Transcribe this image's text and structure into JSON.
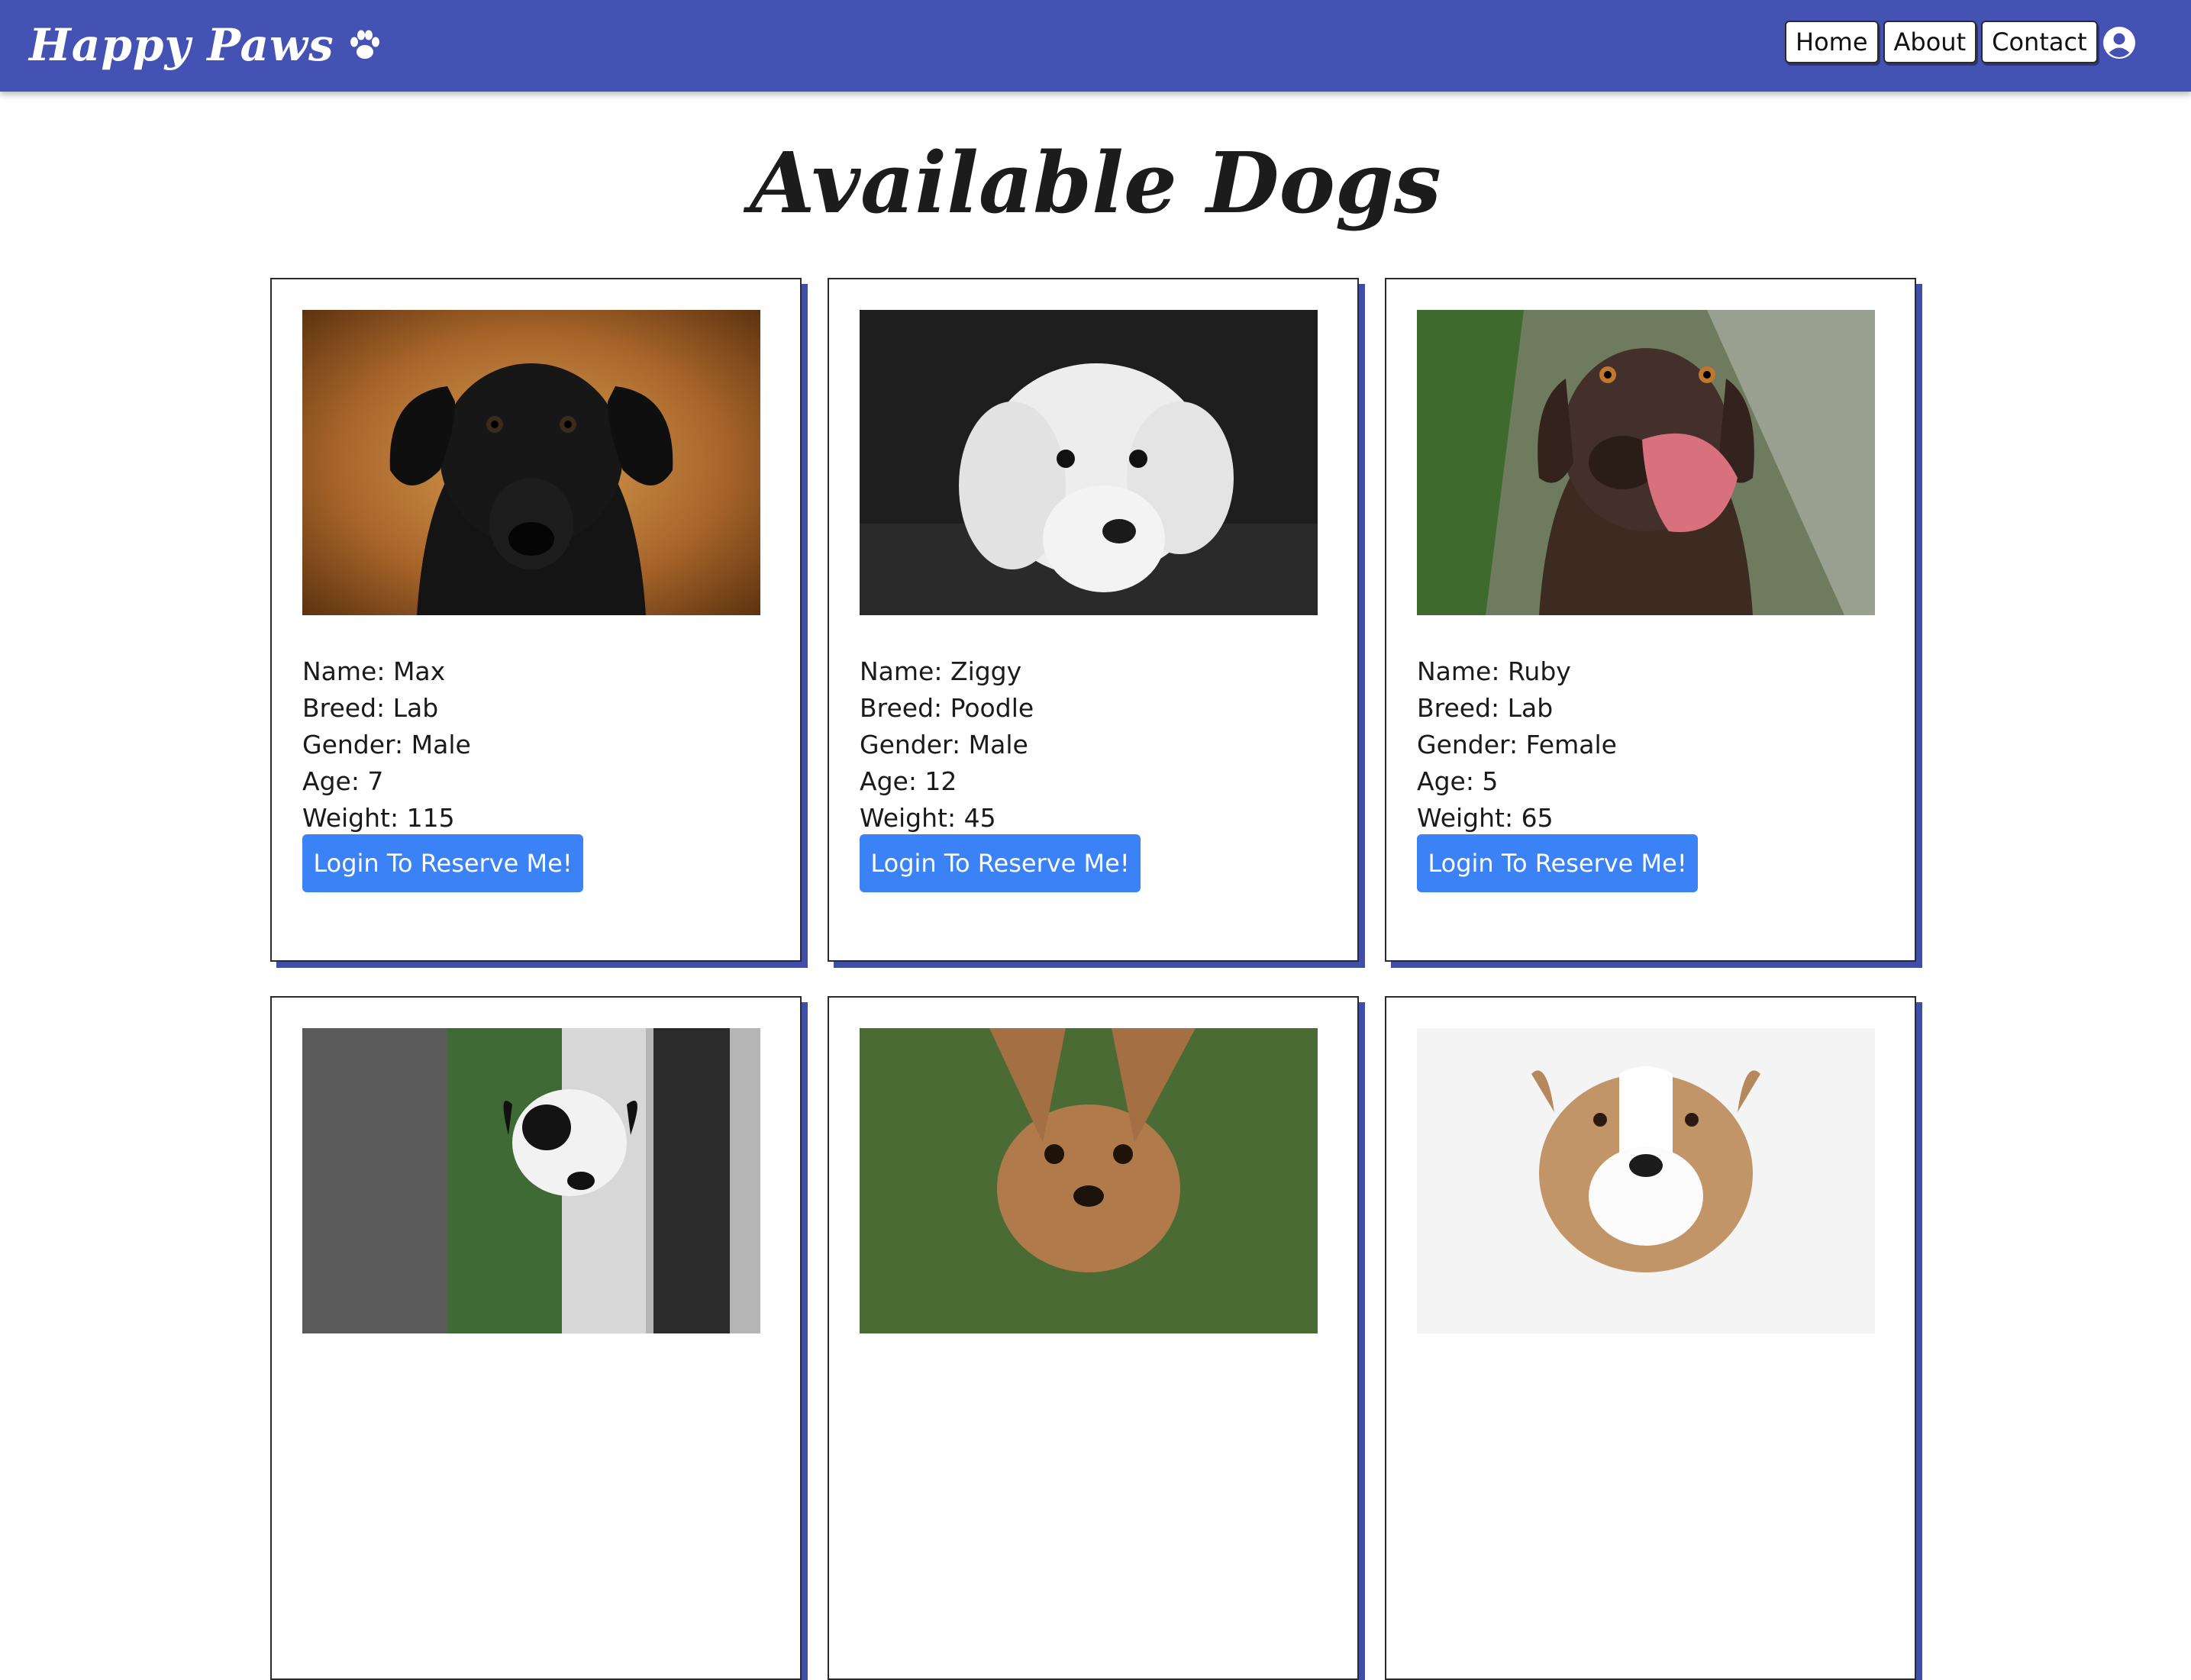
{
  "brand": {
    "name": "Happy Paws",
    "icon": "paw-icon"
  },
  "nav": {
    "links": [
      "Home",
      "About",
      "Contact"
    ],
    "user_icon": "user-circle-icon"
  },
  "page": {
    "title": "Available Dogs"
  },
  "colors": {
    "navbar": "#4453b3",
    "button": "#3b82f6",
    "card_shadow": "#3f4ea8"
  },
  "cards": [
    {
      "name": "Name: Max",
      "breed": "Breed: Lab",
      "gender": "Gender: Male",
      "age": "Age: 7",
      "weight": "Weight: 115",
      "button": "Login To Reserve Me!"
    },
    {
      "name": "Name: Ziggy",
      "breed": "Breed: Poodle",
      "gender": "Gender: Male",
      "age": "Age: 12",
      "weight": "Weight: 45",
      "button": "Login To Reserve Me!"
    },
    {
      "name": "Name: Ruby",
      "breed": "Breed: Lab",
      "gender": "Gender: Female",
      "age": "Age: 5",
      "weight": "Weight: 65",
      "button": "Login To Reserve Me!"
    }
  ]
}
